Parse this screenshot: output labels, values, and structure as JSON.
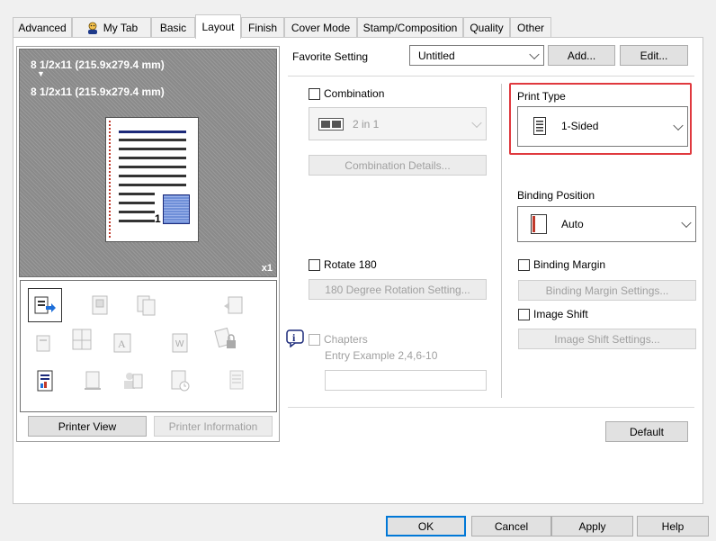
{
  "tabs": [
    {
      "label": "Advanced"
    },
    {
      "label": "My Tab"
    },
    {
      "label": "Basic"
    },
    {
      "label": "Layout"
    },
    {
      "label": "Finish"
    },
    {
      "label": "Cover Mode"
    },
    {
      "label": "Stamp/Composition"
    },
    {
      "label": "Quality"
    },
    {
      "label": "Other"
    }
  ],
  "preview": {
    "paper_size_1": "8 1/2x11 (215.9x279.4 mm)",
    "paper_size_2": "8 1/2x11 (215.9x279.4 mm)",
    "page_number": "1",
    "copies": "x1"
  },
  "left_buttons": {
    "printer_view": "Printer View",
    "printer_information": "Printer Information"
  },
  "favorite": {
    "label": "Favorite Setting",
    "value": "Untitled",
    "add": "Add...",
    "edit": "Edit..."
  },
  "combination": {
    "label": "Combination",
    "value": "2 in 1",
    "details": "Combination Details..."
  },
  "rotate": {
    "label": "Rotate 180",
    "settings": "180 Degree Rotation Setting..."
  },
  "chapters": {
    "label": "Chapters",
    "example": "Entry Example 2,4,6-10",
    "value": ""
  },
  "print_type": {
    "label": "Print Type",
    "value": "1-Sided",
    "highlight_color": "#e0393e"
  },
  "binding_position": {
    "label": "Binding Position",
    "value": "Auto"
  },
  "binding_margin": {
    "label": "Binding Margin",
    "settings": "Binding Margin Settings..."
  },
  "image_shift": {
    "label": "Image Shift",
    "settings": "Image Shift Settings..."
  },
  "default_button": "Default",
  "dialog_buttons": {
    "ok": "OK",
    "cancel": "Cancel",
    "apply": "Apply",
    "help": "Help"
  },
  "colors": {
    "accent": "#0078d7",
    "page_line": "#1c2a7a",
    "binding_red": "#c0392b"
  }
}
